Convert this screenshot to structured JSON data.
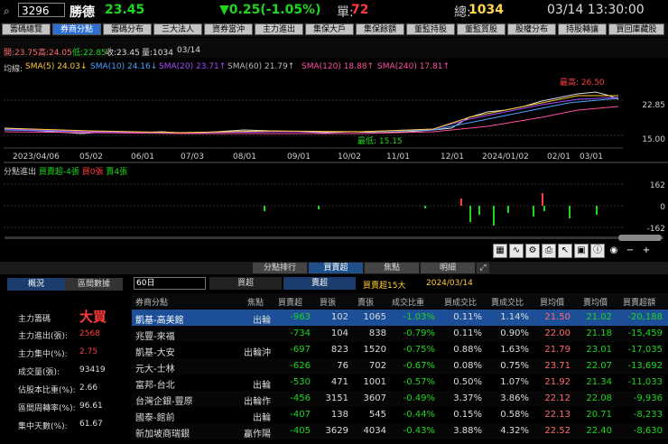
{
  "header": {
    "code": "3296",
    "name": "勝德",
    "price": "23.45",
    "change": "▼0.25(-1.05%)",
    "volume_label": "單:",
    "volume": "72",
    "total_label": "總:",
    "total": "1034",
    "datetime": "03/14 13:30:00"
  },
  "tabs": [
    "籌碼總覽",
    "券商分點",
    "籌碼分布",
    "三大法人",
    "資券當沖",
    "主力進出",
    "集保大戶",
    "集保餘額",
    "董監持股",
    "董監質股",
    "股權分布",
    "持股轉讓",
    "買回庫藏股"
  ],
  "ohlc": {
    "open": "開:23.75",
    "high": "高:24.05",
    "low": "低:22.85",
    "close": "收:23.45",
    "vol": "量:1034",
    "date": "03/14"
  },
  "sma": {
    "label": "均線:",
    "sma5": "SMA(5) 24.03↓",
    "sma10": "SMA(10) 24.16↓",
    "sma20": "SMA(20) 23.71↑",
    "sma60": "SMA(60) 21.79↑",
    "sma120": "SMA(120) 18.88↑",
    "sma240": "SMA(240) 17.81↑"
  },
  "chart": {
    "high_note": "最高: 26.50",
    "low_note": "最低: 15.15",
    "y_ticks": [
      "22.85",
      "15.00"
    ],
    "x_ticks": [
      "2023/04/06",
      "05/02",
      "06/01",
      "07/03",
      "08/01",
      "09/01",
      "10/02",
      "11/01",
      "12/01",
      "2024/01/02",
      "02/01",
      "03/01"
    ],
    "sub_y_ticks": [
      "162",
      "0",
      "-162"
    ]
  },
  "sub_chart": {
    "label": "分點進出",
    "net": "買賣超-4張",
    "buy": "買0張",
    "sell": "賣4張"
  },
  "subtabs": [
    "分點排行",
    "買賣超",
    "焦點",
    "明細"
  ],
  "left_panel": {
    "tab1": "概況",
    "tab2": "區間數據",
    "status_label": "主力籌碼",
    "status": "大買",
    "rows": [
      {
        "label": "主力進出(張):",
        "value": "2568"
      },
      {
        "label": "主力集中(%):",
        "value": "2.75"
      },
      {
        "label": "成交量(張):",
        "value": "93419"
      },
      {
        "label": "佔股本比重(%):",
        "value": "2.66"
      },
      {
        "label": "區間周轉率(%):",
        "value": "96.61"
      },
      {
        "label": "集中天數(%):",
        "value": "61.67"
      }
    ]
  },
  "filter": {
    "period": "60日",
    "buy_label": "買超",
    "sell_label": "賣超",
    "summary": "買賣超15大",
    "date": "2024/03/14"
  },
  "table": {
    "headers": [
      "券商分點",
      "焦點",
      "買賣超",
      "買張",
      "賣張",
      "成交比重",
      "買成交比",
      "賣成交比",
      "買均價",
      "賣均價",
      "買賣超額"
    ],
    "rows": [
      [
        "凱基-高美館",
        "出輪",
        "-963",
        "102",
        "1065",
        "-1.03%",
        "0.11%",
        "1.14%",
        "21.50",
        "21.02",
        "-20,188"
      ],
      [
        "兆豐-來福",
        "",
        "-734",
        "104",
        "838",
        "-0.79%",
        "0.11%",
        "0.90%",
        "22.00",
        "21.18",
        "-15,459"
      ],
      [
        "凱基-大安",
        "出輪沖",
        "-697",
        "823",
        "1520",
        "-0.75%",
        "0.88%",
        "1.63%",
        "21.79",
        "23.01",
        "-17,035"
      ],
      [
        "元大-士林",
        "",
        "-626",
        "76",
        "702",
        "-0.67%",
        "0.08%",
        "0.75%",
        "23.71",
        "22.07",
        "-13,692"
      ],
      [
        "富邦-台北",
        "出輪",
        "-530",
        "471",
        "1001",
        "-0.57%",
        "0.50%",
        "1.07%",
        "21.92",
        "21.34",
        "-11,033"
      ],
      [
        "台灣企銀-豐原",
        "出輪作沖",
        "-456",
        "3151",
        "3607",
        "-0.49%",
        "3.37%",
        "3.86%",
        "22.12",
        "22.08",
        "-9,936"
      ],
      [
        "國泰-館前",
        "出輪",
        "-407",
        "138",
        "545",
        "-0.44%",
        "0.15%",
        "0.58%",
        "22.13",
        "20.71",
        "-8,233"
      ],
      [
        "新加坡商瑞銀",
        "贏作陽",
        "-405",
        "3629",
        "4034",
        "-0.43%",
        "3.88%",
        "4.32%",
        "22.52",
        "22.40",
        "-8,630"
      ]
    ]
  },
  "colors": {
    "up": "#ff3c3c",
    "down": "#1fd61f",
    "accent": "#2e6fd1"
  }
}
